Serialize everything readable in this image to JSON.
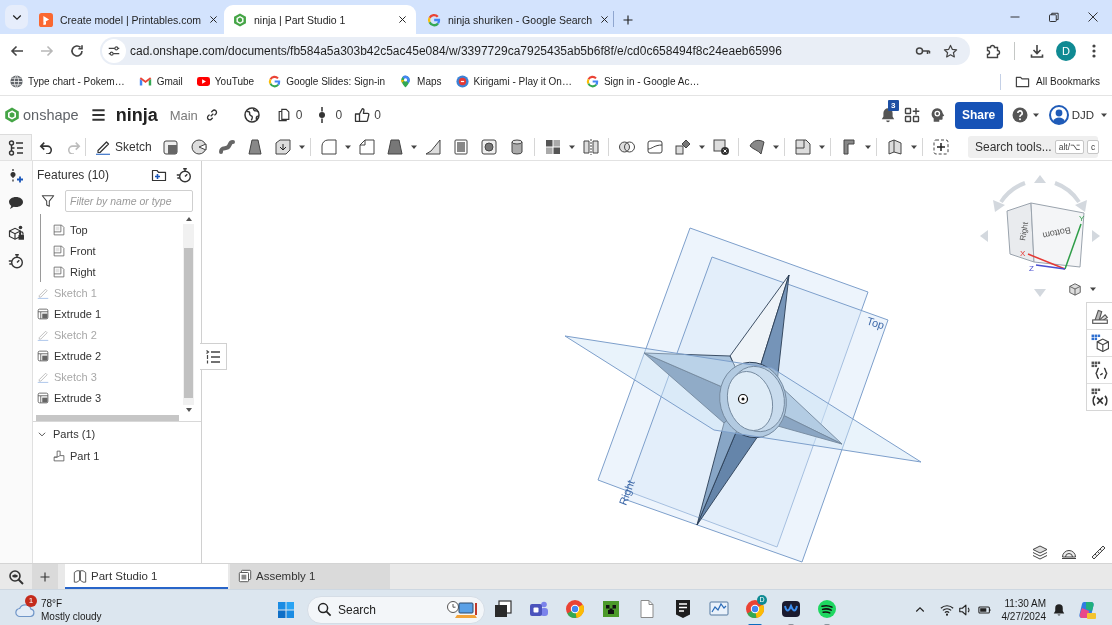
{
  "browser": {
    "tabs": [
      {
        "kind": "printables",
        "title": "Create model | Printables.com",
        "selected": false
      },
      {
        "kind": "onshape",
        "title": "ninja | Part Studio 1",
        "selected": true
      },
      {
        "kind": "google",
        "title": "ninja shuriken - Google Search",
        "selected": false
      }
    ],
    "nav": [
      {
        "kind": "back",
        "disabled": false
      },
      {
        "kind": "forward",
        "disabled": true
      },
      {
        "kind": "reload",
        "disabled": false
      }
    ],
    "address": "cad.onshape.com/documents/fb584a5a303b42c5ac45e084/w/3397729ca7925435ab5b6f8f/e/cd0c658494f8c24eaeb65996",
    "profile_initial": "D",
    "bookmarks": [
      {
        "kind": "globe",
        "label": "Type chart - Pokem…"
      },
      {
        "kind": "mail",
        "label": "Gmail"
      },
      {
        "kind": "video",
        "label": "YouTube"
      },
      {
        "kind": "google",
        "label": "Google Slides: Sign-in"
      },
      {
        "kind": "pin",
        "label": "Maps"
      },
      {
        "kind": "game",
        "label": "Kirigami - Play it On…"
      },
      {
        "kind": "google",
        "label": "Sign in - Google Ac…"
      }
    ],
    "all_bookmarks": "All Bookmarks"
  },
  "app": {
    "logo": "onshape",
    "document": "ninja",
    "branch": "Main",
    "stats": [
      {
        "kind": "copies",
        "value": "0"
      },
      {
        "kind": "links",
        "value": "0"
      },
      {
        "kind": "likes",
        "value": "0"
      }
    ],
    "notifications": "3",
    "share": "Share",
    "user": "DJD"
  },
  "toolbar": {
    "history": [
      {
        "kind": "undo",
        "disabled": false
      },
      {
        "kind": "redo",
        "disabled": true
      }
    ],
    "sketch": "Sketch",
    "search": {
      "label": "Search tools...",
      "keys": [
        "alt/⌥",
        "c"
      ]
    }
  },
  "features": {
    "title": "Features (10)",
    "filter": {
      "placeholder": "Filter by name or type"
    },
    "items": [
      {
        "kind": "group",
        "children": [
          {
            "kind": "plane",
            "label": "Top",
            "hidden": false
          },
          {
            "kind": "plane",
            "label": "Front",
            "hidden": false
          },
          {
            "kind": "plane",
            "label": "Right",
            "hidden": false
          }
        ]
      },
      {
        "kind": "sketch",
        "label": "Sketch 1",
        "hidden": true
      },
      {
        "kind": "extrude",
        "label": "Extrude 1",
        "hidden": false
      },
      {
        "kind": "sketch",
        "label": "Sketch 2",
        "hidden": true
      },
      {
        "kind": "extrude",
        "label": "Extrude 2",
        "hidden": false
      },
      {
        "kind": "sketch",
        "label": "Sketch 3",
        "hidden": true
      },
      {
        "kind": "extrude",
        "label": "Extrude 3",
        "hidden": false
      }
    ]
  },
  "parts": {
    "title": "Parts (1)",
    "expanded": true,
    "items": [
      {
        "label": "Part 1"
      }
    ]
  },
  "viewport": {
    "planes": [
      {
        "label": "Right"
      },
      {
        "label": "Top"
      }
    ],
    "view_cube": {
      "faces": [
        "Right",
        "Bottom"
      ],
      "axes": [
        "X",
        "Y",
        "Z"
      ]
    }
  },
  "doc_tabs": [
    {
      "kind": "part-studio",
      "label": "Part Studio 1",
      "selected": true
    },
    {
      "kind": "assembly",
      "label": "Assembly 1",
      "selected": false
    }
  ],
  "taskbar": {
    "weather": {
      "temperature": "78°F",
      "condition": "Mostly cloudy",
      "badge": "1"
    },
    "search": {
      "placeholder": "Search"
    },
    "apps": [
      {
        "kind": "stack",
        "running": false,
        "active": false
      },
      {
        "kind": "people",
        "running": false,
        "active": false
      },
      {
        "kind": "browser",
        "running": false,
        "active": false
      },
      {
        "kind": "block",
        "running": false,
        "active": false
      },
      {
        "kind": "document",
        "running": false,
        "active": false
      },
      {
        "kind": "shield",
        "running": false,
        "active": false
      },
      {
        "kind": "chart",
        "running": false,
        "active": false
      },
      {
        "kind": "browser",
        "badge": "D",
        "running": true,
        "active": true
      },
      {
        "kind": "waves",
        "running": true,
        "active": false
      },
      {
        "kind": "music",
        "running": true,
        "active": false
      }
    ],
    "time": "11:30 AM",
    "date": "4/27/2024"
  }
}
